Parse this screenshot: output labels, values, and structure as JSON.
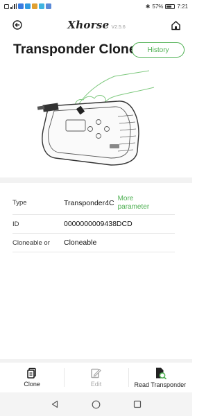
{
  "status_bar": {
    "battery": "57%",
    "battery_level": 0.57,
    "time": "7:21"
  },
  "header": {
    "brand": "Xhorse",
    "version": "V2.5.6",
    "back_icon": "back-arrow-icon",
    "home_icon": "home-icon"
  },
  "page": {
    "title": "Transponder Clone",
    "history_label": "History"
  },
  "info": {
    "type_label": "Type",
    "type_value": "Transponder4C",
    "more_parameter": "More parameter",
    "id_label": "ID",
    "id_value": "0000000009438DCD",
    "cloneable_label": "Cloneable or",
    "cloneable_value": "Cloneable"
  },
  "bottom_tabs": [
    {
      "label": "Clone",
      "icon": "clone-icon"
    },
    {
      "label": "Edit",
      "icon": "edit-icon"
    },
    {
      "label": "Read Transponder",
      "icon": "read-transponder-icon"
    }
  ],
  "colors": {
    "accent": "#4caf50",
    "text": "#1a1a1a"
  }
}
